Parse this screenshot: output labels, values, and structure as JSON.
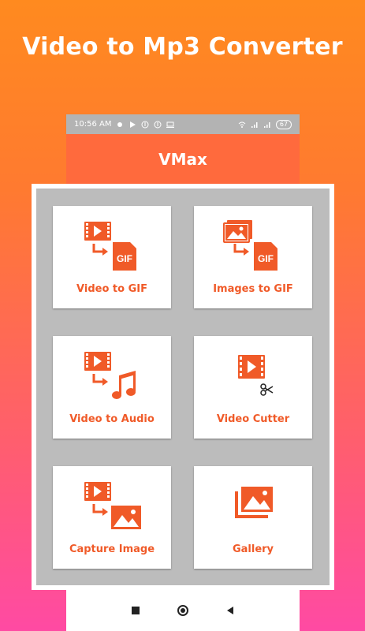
{
  "hero": {
    "title": "Video to Mp3 Converter"
  },
  "status_bar": {
    "time": "10:56 AM",
    "battery": "67"
  },
  "app_bar": {
    "title": "VMax"
  },
  "menu": {
    "items": [
      {
        "label": "Video to GIF",
        "icon": "video-to-gif-icon"
      },
      {
        "label": "Images to GIF",
        "icon": "images-to-gif-icon"
      },
      {
        "label": "Video to Audio",
        "icon": "video-to-audio-icon"
      },
      {
        "label": "Video Cutter",
        "icon": "video-cutter-icon"
      },
      {
        "label": "Capture Image",
        "icon": "capture-image-icon"
      },
      {
        "label": "Gallery",
        "icon": "gallery-icon"
      }
    ]
  },
  "colors": {
    "accent": "#f05a28",
    "appbar": "#ff6a3d",
    "panel_bg": "#bcbcbc"
  }
}
